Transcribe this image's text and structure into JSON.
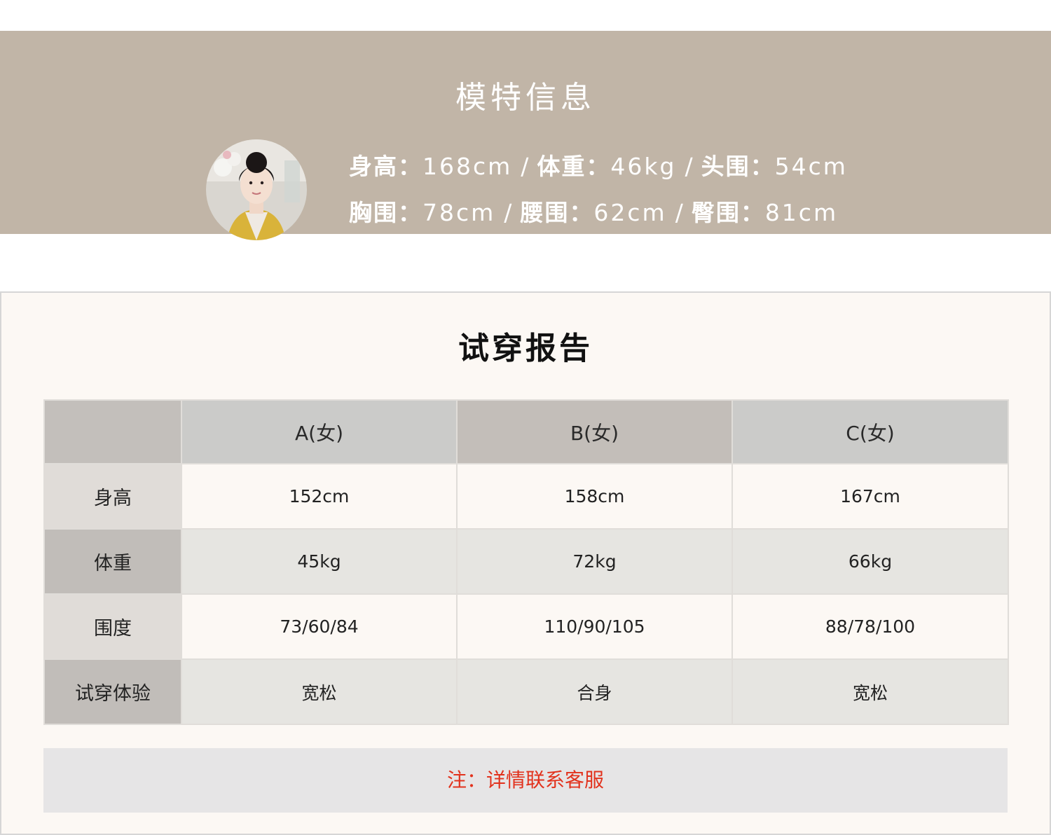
{
  "model_info": {
    "title": "模特信息",
    "stats_row1": [
      {
        "label": "身高：",
        "value": "168cm"
      },
      {
        "label": "体重：",
        "value": "46kg"
      },
      {
        "label": "头围：",
        "value": "54cm"
      }
    ],
    "stats_row2": [
      {
        "label": "胸围：",
        "value": "78cm"
      },
      {
        "label": "腰围：",
        "value": "62cm"
      },
      {
        "label": "臀围：",
        "value": "81cm"
      }
    ],
    "separator": "/"
  },
  "report": {
    "title": "试穿报告",
    "columns": [
      "A(女)",
      "B(女)",
      "C(女)"
    ],
    "rows": [
      {
        "label": "身高",
        "values": [
          "152cm",
          "158cm",
          "167cm"
        ]
      },
      {
        "label": "体重",
        "values": [
          "45kg",
          "72kg",
          "66kg"
        ]
      },
      {
        "label": "围度",
        "values": [
          "73/60/84",
          "110/90/105",
          "88/78/100"
        ]
      },
      {
        "label": "试穿体验",
        "values": [
          "宽松",
          "合身",
          "宽松"
        ]
      }
    ],
    "note": "注：详情联系客服"
  },
  "colors": {
    "banner_bg": "#c1b5a7",
    "panel_bg": "#fcf8f4",
    "note_text": "#e2321d"
  }
}
